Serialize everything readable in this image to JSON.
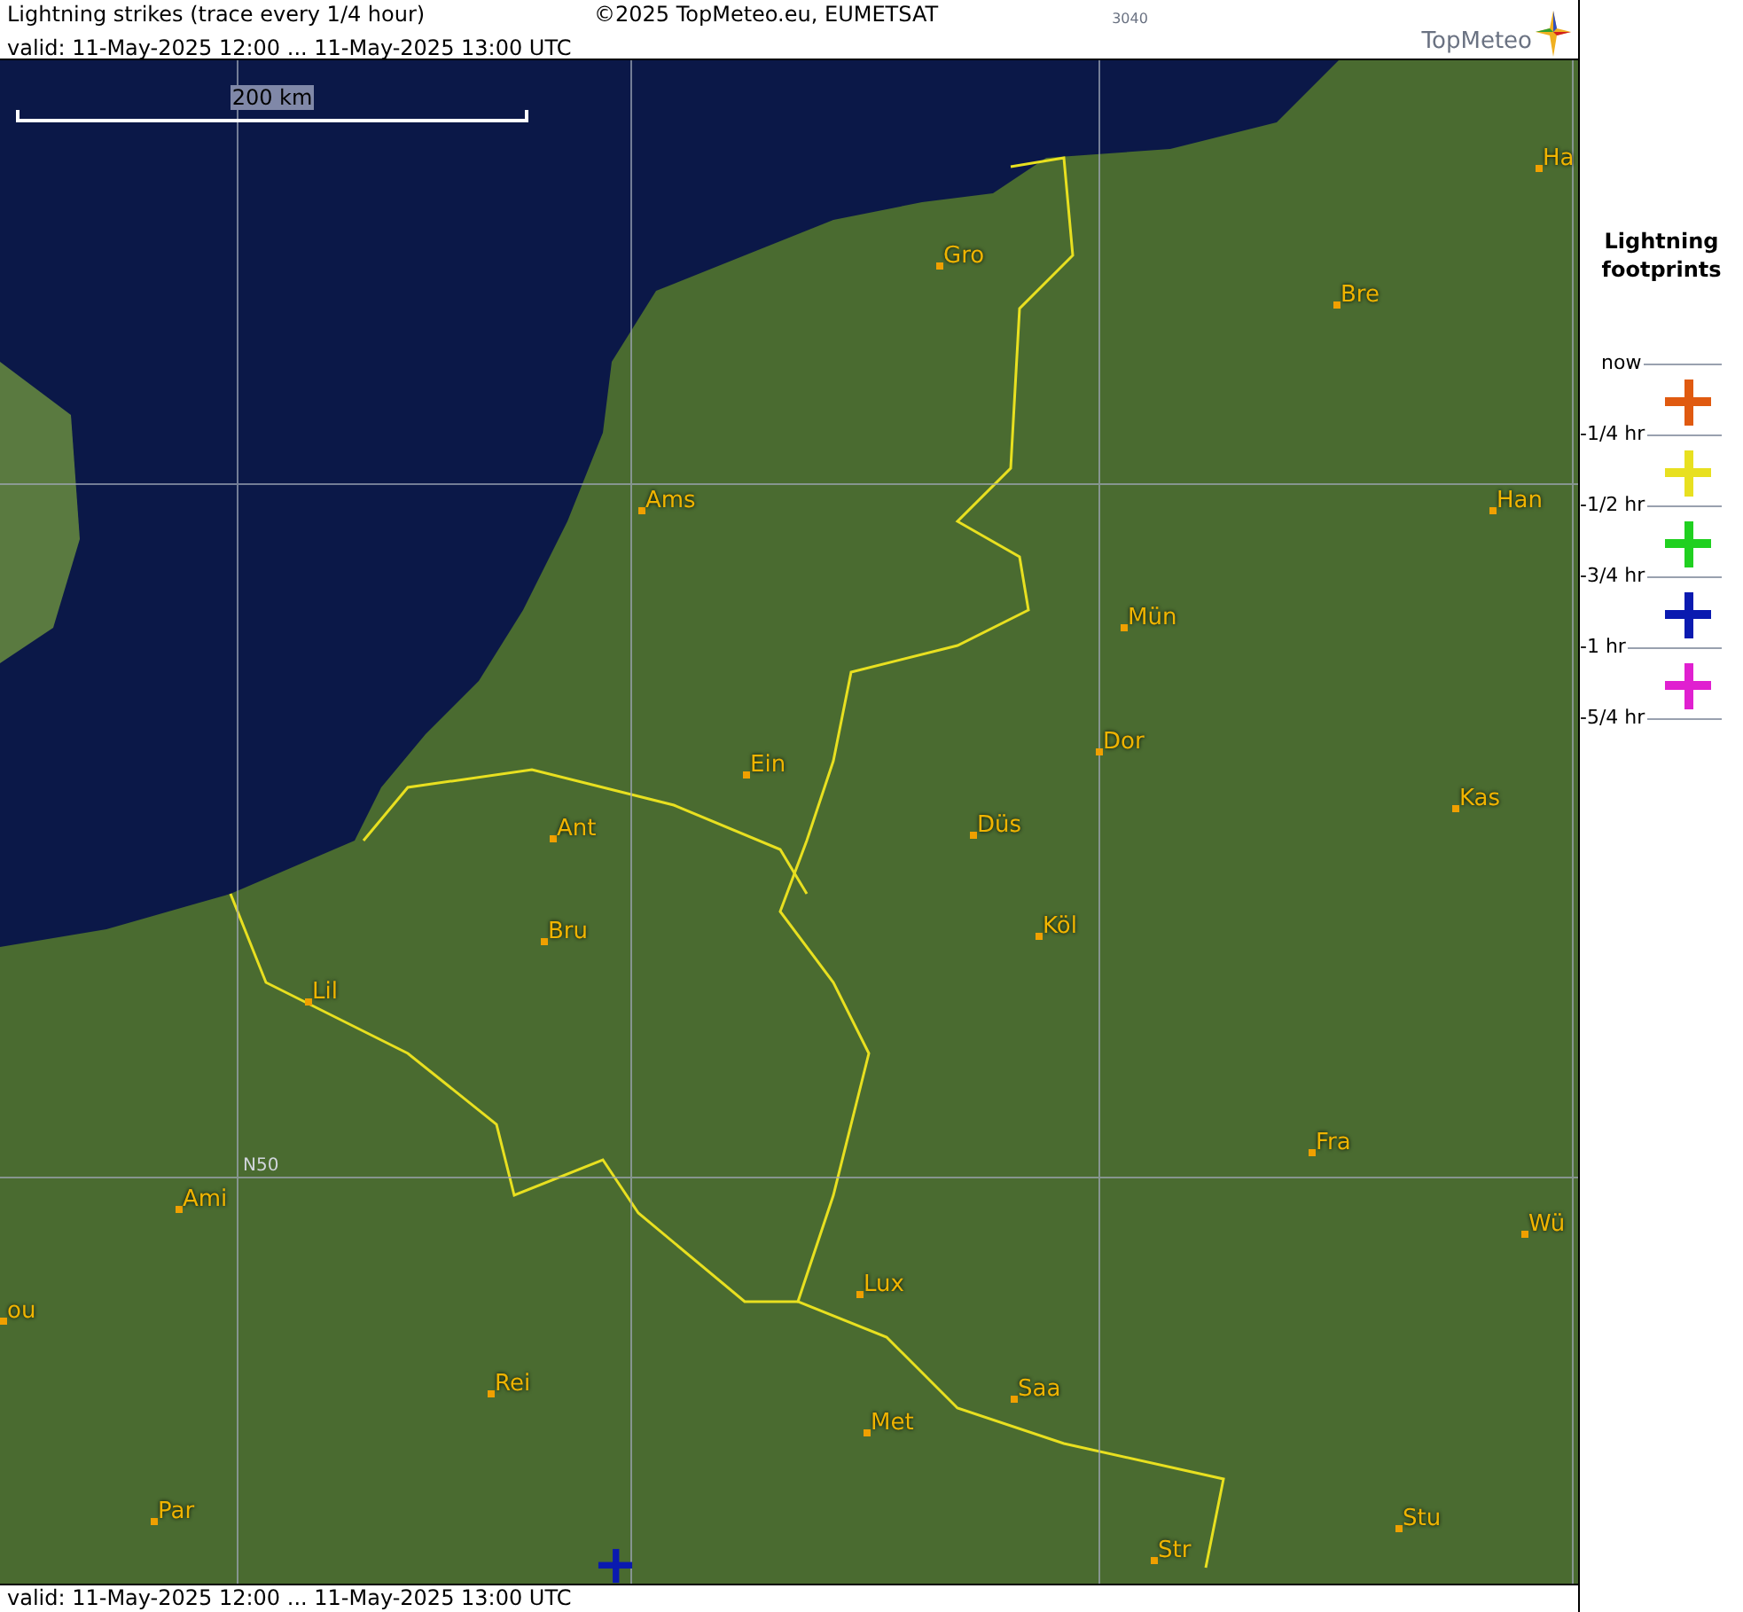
{
  "header": {
    "title": "Lightning strikes (trace every 1/4 hour)",
    "copyright": "©2025 TopMeteo.eu, EUMETSAT",
    "code": "3040",
    "valid": "valid:  11-May-2025 12:00 ... 11-May-2025 13:00 UTC",
    "logo": "TopMeteo"
  },
  "map": {
    "scale": "200 km",
    "grid_label": "N50",
    "cities": [
      {
        "name": "Ha"
      },
      {
        "name": "Gro"
      },
      {
        "name": "Bre"
      },
      {
        "name": "Ams"
      },
      {
        "name": "Han"
      },
      {
        "name": "Mün"
      },
      {
        "name": "Dor"
      },
      {
        "name": "Ein"
      },
      {
        "name": "Kas"
      },
      {
        "name": "Düs"
      },
      {
        "name": "Ant"
      },
      {
        "name": "Köl"
      },
      {
        "name": "Bru"
      },
      {
        "name": "Lil"
      },
      {
        "name": "Fra"
      },
      {
        "name": "Ami"
      },
      {
        "name": "Wü"
      },
      {
        "name": "Lux"
      },
      {
        "name": "ou"
      },
      {
        "name": "Rei"
      },
      {
        "name": "Saa"
      },
      {
        "name": "Met"
      },
      {
        "name": "Stu"
      },
      {
        "name": "Par"
      },
      {
        "name": "Str"
      }
    ],
    "strikes": [
      {
        "color": "#0a1ab0"
      }
    ]
  },
  "legend": {
    "title": "Lightning footprints",
    "ticks": [
      "now",
      "-1/4 hr",
      "-1/2 hr",
      "-3/4 hr",
      "-1 hr",
      "-5/4 hr"
    ],
    "markers": [
      {
        "color": "#e05a10"
      },
      {
        "color": "#e8e020"
      },
      {
        "color": "#20d020"
      },
      {
        "color": "#0a1ab0"
      },
      {
        "color": "#e020d0"
      }
    ]
  },
  "footer": {
    "valid": "valid:  11-May-2025 12:00 ... 11-May-2025 13:00 UTC"
  }
}
